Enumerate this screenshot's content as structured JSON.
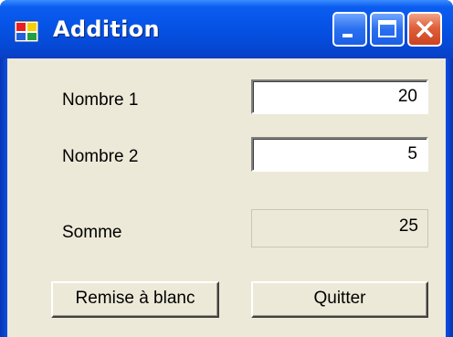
{
  "window": {
    "title": "Addition",
    "icon": "form-icon"
  },
  "titlebar_buttons": {
    "minimize": "minimize-icon",
    "maximize": "maximize-icon",
    "close": "close-icon"
  },
  "form": {
    "nombre1": {
      "label": "Nombre 1",
      "value": "20"
    },
    "nombre2": {
      "label": "Nombre 2",
      "value": "5"
    },
    "somme": {
      "label": "Somme",
      "value": "25"
    }
  },
  "buttons": {
    "reset_label": "Remise à blanc",
    "quit_label": "Quitter"
  },
  "colors": {
    "titlebar": "#0653e6",
    "client": "#ece9d8",
    "close_button": "#e0603a"
  }
}
